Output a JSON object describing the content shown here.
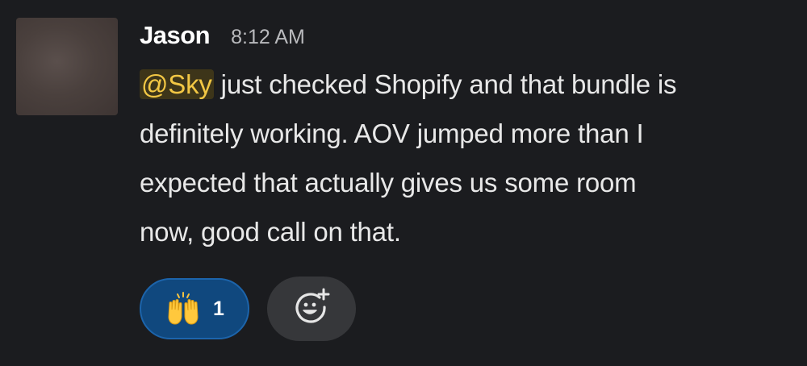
{
  "message": {
    "author": "Jason",
    "timestamp": "8:12 AM",
    "mention": "@Sky",
    "text_line1": " just checked Shopify and that bundle is",
    "text_line2": "definitely working. AOV jumped more than I",
    "text_line3": "expected that actually gives us some room",
    "text_line4": "now, good call on that."
  },
  "reactions": [
    {
      "emoji_name": "raised-hands-icon",
      "count": "1"
    }
  ],
  "add_reaction": {
    "icon_name": "add-reaction-icon"
  },
  "colors": {
    "background": "#1b1c1f",
    "mention_text": "#f2c744",
    "mention_bg": "#3d3519",
    "reaction_bg": "#10487e",
    "reaction_border": "#1c64ab",
    "add_reaction_bg": "#36373a"
  }
}
